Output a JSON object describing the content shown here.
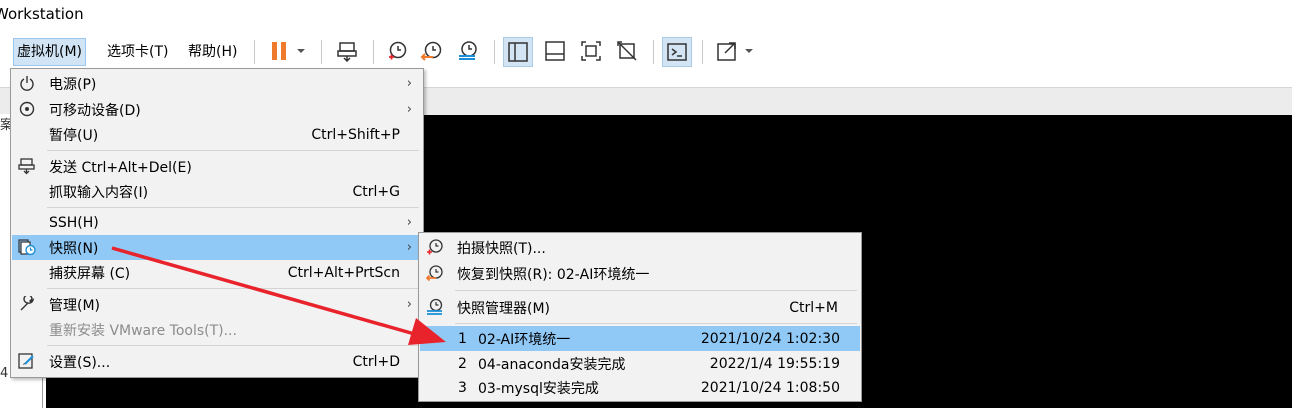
{
  "window": {
    "title": "Workstation"
  },
  "menubar": [
    {
      "label": "虚拟机(M)",
      "active": true
    },
    {
      "label": "选项卡(T)",
      "active": false
    },
    {
      "label": "帮助(H)",
      "active": false
    }
  ],
  "toolbar": {
    "icons": [
      "pause-icon",
      "dropdown-arrow-icon",
      "send-ctrl-alt-del-icon",
      "take-snapshot-icon",
      "revert-snapshot-icon",
      "snapshot-manager-icon",
      "library-view-icon",
      "thumbnail-bar-icon",
      "fit-guest-icon",
      "unity-icon",
      "console-view-icon",
      "fullscreen-icon",
      "fullscreen-dropdown-icon"
    ]
  },
  "left_fragments": {
    "top": "案",
    "bottom": "4"
  },
  "vm_menu": {
    "items": [
      {
        "label": "电源(P)",
        "shortcut": "",
        "submenu": true,
        "icon": "power-icon"
      },
      {
        "label": "可移动设备(D)",
        "shortcut": "",
        "submenu": true,
        "icon": "removable-device-icon"
      },
      {
        "label": "暂停(U)",
        "shortcut": "Ctrl+Shift+P",
        "submenu": false,
        "icon": ""
      },
      {
        "label": "发送 Ctrl+Alt+Del(E)",
        "shortcut": "",
        "submenu": false,
        "icon": "send-keys-icon"
      },
      {
        "label": "抓取输入内容(I)",
        "shortcut": "Ctrl+G",
        "submenu": false,
        "icon": ""
      },
      {
        "label": "SSH(H)",
        "shortcut": "",
        "submenu": true,
        "icon": ""
      },
      {
        "label": "快照(N)",
        "shortcut": "",
        "submenu": true,
        "icon": "snapshot-icon",
        "highlighted": true
      },
      {
        "label": "捕获屏幕 (C)",
        "shortcut": "Ctrl+Alt+PrtScn",
        "submenu": false,
        "icon": ""
      },
      {
        "label": "管理(M)",
        "shortcut": "",
        "submenu": true,
        "icon": "wrench-icon"
      },
      {
        "label": "重新安装 VMware Tools(T)...",
        "shortcut": "",
        "submenu": false,
        "icon": "",
        "disabled": true
      },
      {
        "label": "设置(S)...",
        "shortcut": "Ctrl+D",
        "submenu": false,
        "icon": "settings-icon"
      }
    ]
  },
  "snapshot_menu": {
    "take": {
      "label": "拍摄快照(T)..."
    },
    "revert": {
      "label": "恢复到快照(R): 02-AI环境统一"
    },
    "manager": {
      "label": "快照管理器(M)",
      "shortcut": "Ctrl+M"
    },
    "snapshots": [
      {
        "num": "1",
        "name": "02-AI环境统一",
        "date": "2021/10/24 1:02:30",
        "highlighted": true
      },
      {
        "num": "2",
        "name": "04-anaconda安装完成",
        "date": "2022/1/4 19:55:19",
        "highlighted": false
      },
      {
        "num": "3",
        "name": "03-mysql安装完成",
        "date": "2021/10/24 1:08:50",
        "highlighted": false
      }
    ]
  },
  "colors": {
    "highlight": "#90c8f6",
    "annotation_arrow": "#e8232b",
    "pause_icon": "#f07a2b"
  }
}
